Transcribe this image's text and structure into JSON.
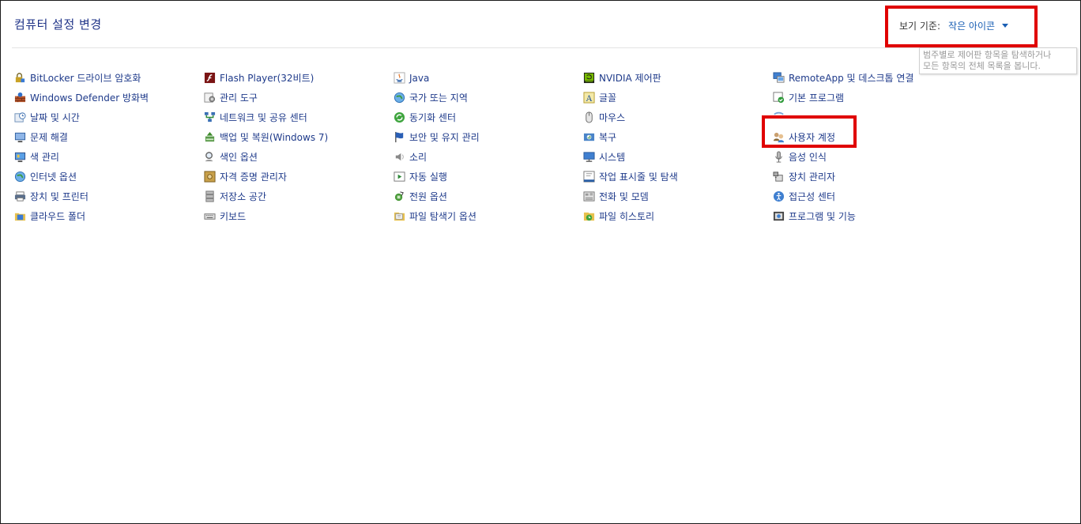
{
  "header": {
    "title": "컴퓨터 설정 변경",
    "view_by_label": "보기 기준:",
    "view_by_value": "작은 아이콘",
    "tooltip_line1": "범주별로 제어판 항목을 탐색하거나",
    "tooltip_line2": "모든 항목의 전체 목록을 봅니다."
  },
  "columns": [
    [
      {
        "label": "BitLocker 드라이브 암호화",
        "icon": "bitlocker-icon"
      },
      {
        "label": "Windows Defender 방화벽",
        "icon": "firewall-icon"
      },
      {
        "label": "날짜 및 시간",
        "icon": "clock-icon"
      },
      {
        "label": "문제 해결",
        "icon": "troubleshoot-icon"
      },
      {
        "label": "색 관리",
        "icon": "monitor-icon"
      },
      {
        "label": "인터넷 옵션",
        "icon": "globe-icon"
      },
      {
        "label": "장치 및 프린터",
        "icon": "printer-icon"
      },
      {
        "label": "클라우드 폴더",
        "icon": "folder-icon"
      }
    ],
    [
      {
        "label": "Flash Player(32비트)",
        "icon": "flash-icon"
      },
      {
        "label": "관리 도구",
        "icon": "gear-icon"
      },
      {
        "label": "네트워크 및 공유 센터",
        "icon": "network-icon"
      },
      {
        "label": "백업 및 복원(Windows 7)",
        "icon": "backup-icon"
      },
      {
        "label": "색인 옵션",
        "icon": "search-icon"
      },
      {
        "label": "자격 증명 관리자",
        "icon": "safe-icon"
      },
      {
        "label": "저장소 공간",
        "icon": "storage-icon"
      },
      {
        "label": "키보드",
        "icon": "keyboard-icon"
      }
    ],
    [
      {
        "label": "Java",
        "icon": "java-icon"
      },
      {
        "label": "국가 또는 지역",
        "icon": "globe-icon"
      },
      {
        "label": "동기화 센터",
        "icon": "sync-icon"
      },
      {
        "label": "보안 및 유지 관리",
        "icon": "flag-icon"
      },
      {
        "label": "소리",
        "icon": "speaker-icon"
      },
      {
        "label": "자동 실행",
        "icon": "autoplay-icon"
      },
      {
        "label": "전원 옵션",
        "icon": "power-icon"
      },
      {
        "label": "파일 탐색기 옵션",
        "icon": "folder-options-icon"
      }
    ],
    [
      {
        "label": "NVIDIA 제어판",
        "icon": "nvidia-icon"
      },
      {
        "label": "글꼴",
        "icon": "font-icon"
      },
      {
        "label": "마우스",
        "icon": "mouse-icon"
      },
      {
        "label": "복구",
        "icon": "recovery-icon"
      },
      {
        "label": "시스템",
        "icon": "system-icon"
      },
      {
        "label": "작업 표시줄 및 탐색",
        "icon": "taskbar-icon"
      },
      {
        "label": "전화 및 모뎀",
        "icon": "phone-icon"
      },
      {
        "label": "파일 히스토리",
        "icon": "history-icon"
      }
    ],
    [
      {
        "label": "RemoteApp 및 데스크톱 연결",
        "icon": "remoteapp-icon"
      },
      {
        "label": "기본 프로그램",
        "icon": "default-programs-icon"
      },
      {
        "label": "",
        "icon": "partially-hidden-icon"
      },
      {
        "label": "사용자 계정",
        "icon": "users-icon"
      },
      {
        "label": "음성 인식",
        "icon": "microphone-icon"
      },
      {
        "label": "장치 관리자",
        "icon": "device-manager-icon"
      },
      {
        "label": "접근성 센터",
        "icon": "accessibility-icon"
      },
      {
        "label": "프로그램 및 기능",
        "icon": "programs-icon"
      }
    ]
  ],
  "colors": {
    "title": "#1e3287",
    "link": "#1e3a8a",
    "accent": "#1a5fb4",
    "highlight": "#e00000"
  }
}
